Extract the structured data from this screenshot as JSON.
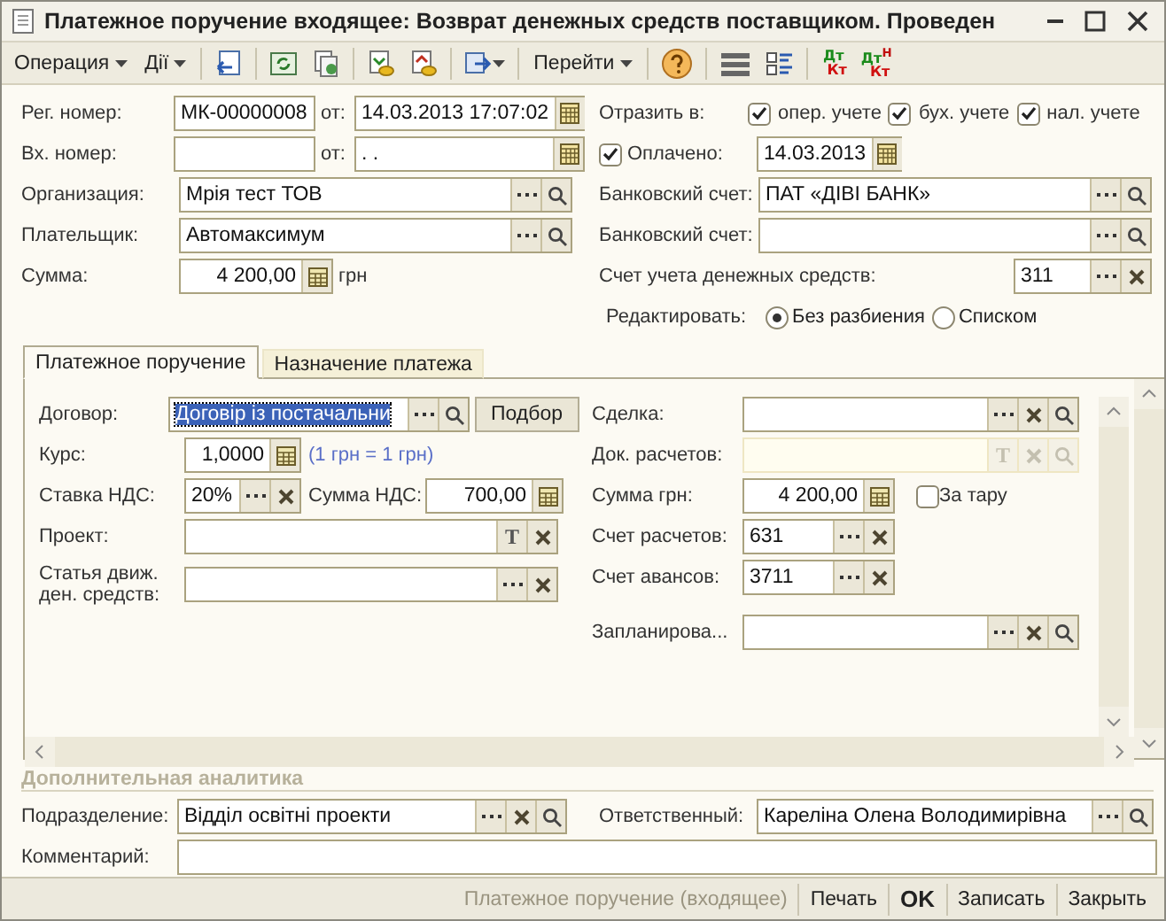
{
  "window": {
    "title": "Платежное поручение входящее: Возврат денежных средств поставщиком. Проведен"
  },
  "toolbar": {
    "menus": [
      "Операция",
      "Дії"
    ],
    "goto_menu": "Перейти",
    "dt_kt": [
      {
        "top": "Дт",
        "bottom": "Кт"
      },
      {
        "top": "Дт",
        "sup": "Н",
        "bottom": "Кт"
      }
    ]
  },
  "header": {
    "reg_number": {
      "label": "Рег. номер:",
      "value": "МК-00000008",
      "date_label": "от:",
      "date": "14.03.2013 17:07:02"
    },
    "in_number": {
      "label": "Вх. номер:",
      "date_label": "от:",
      "date": " .  ."
    },
    "organization": {
      "label": "Организация:",
      "value": "Мрія тест ТОВ",
      "buttons": [
        {
          "kind": "select"
        },
        {
          "kind": "search"
        }
      ]
    },
    "payer": {
      "label": "Плательщик:",
      "value": "Автомаксимум",
      "buttons": [
        {
          "kind": "select"
        },
        {
          "kind": "search"
        }
      ]
    },
    "amount": {
      "label": "Сумма:",
      "value": "4 200,00",
      "unit": "грн"
    },
    "reflect": {
      "label": "Отразить в:",
      "options": [
        {
          "label": "опер. учете",
          "checked": true
        },
        {
          "label": "бух. учете",
          "checked": true
        },
        {
          "label": "нал. учете",
          "checked": true
        }
      ]
    },
    "paid": {
      "label": "Оплачено:",
      "checked": true,
      "date": "14.03.2013"
    },
    "bank_account": {
      "label": "Банковский счет:",
      "value": "ПАТ «ДІВІ БАНК»",
      "buttons": [
        {
          "kind": "select"
        },
        {
          "kind": "search"
        }
      ]
    },
    "bank_account_2": {
      "label": "Банковский счет:",
      "buttons": [
        {
          "kind": "select"
        },
        {
          "kind": "search"
        }
      ]
    },
    "cash_account": {
      "label": "Счет учета денежных средств:",
      "value": "311",
      "buttons": [
        {
          "kind": "select"
        },
        {
          "kind": "clear"
        }
      ]
    },
    "edit_mode": {
      "label": "Редактировать:",
      "options": [
        {
          "label": "Без разбиения",
          "selected": true
        },
        {
          "label": "Списком",
          "selected": false
        }
      ]
    }
  },
  "tabs": [
    {
      "label": "Платежное поручение",
      "selected": true
    },
    {
      "label": "Назначение платежа",
      "selected": false
    }
  ],
  "tab_panel": {
    "contract": {
      "label": "Договор:",
      "value": "Договір із постачальни",
      "highlighted": true,
      "buttons": [
        {
          "kind": "select"
        },
        {
          "kind": "search"
        }
      ],
      "pick_button": "Подбор"
    },
    "rate": {
      "label": "Курс:",
      "value": "1,0000",
      "note": "(1 грн = 1 грн)"
    },
    "vat_rate": {
      "label": "Ставка НДС:",
      "value": "20%",
      "buttons": [
        {
          "kind": "select"
        },
        {
          "kind": "clear"
        }
      ]
    },
    "vat_amount": {
      "label": "Сумма НДС:",
      "value": "700,00"
    },
    "project": {
      "label": "Проект:",
      "buttons": [
        {
          "kind": "text",
          "glyph": "T"
        },
        {
          "kind": "clear"
        }
      ]
    },
    "cash_flow_item": {
      "label": "Статья движ. ден. средств:",
      "buttons": [
        {
          "kind": "select"
        },
        {
          "kind": "clear"
        }
      ]
    },
    "deal": {
      "label": "Сделка:",
      "disabled": false,
      "buttons": [
        {
          "kind": "select"
        },
        {
          "kind": "clear"
        },
        {
          "kind": "search"
        }
      ]
    },
    "settlement_doc": {
      "label": "Док. расчетов:",
      "disabled": true,
      "buttons": [
        {
          "kind": "text",
          "glyph": "T"
        },
        {
          "kind": "clear"
        },
        {
          "kind": "search"
        }
      ]
    },
    "amount_uah": {
      "label": "Сумма грн:",
      "value": "4 200,00"
    },
    "container": {
      "label": "За тару",
      "checked": false
    },
    "settlement_account": {
      "label": "Счет расчетов:",
      "value": "631",
      "buttons": [
        {
          "kind": "select"
        },
        {
          "kind": "clear"
        }
      ]
    },
    "advance_account": {
      "label": "Счет авансов:",
      "value": "3711",
      "buttons": [
        {
          "kind": "select"
        },
        {
          "kind": "clear"
        }
      ]
    },
    "planned": {
      "label": "Запланирова...",
      "disabled": false,
      "buttons": [
        {
          "kind": "select"
        },
        {
          "kind": "clear"
        },
        {
          "kind": "search"
        }
      ]
    }
  },
  "additional": {
    "title": "Дополнительная аналитика",
    "department": {
      "label": "Подразделение:",
      "value": "Відділ освітні проекти",
      "buttons": [
        {
          "kind": "select"
        },
        {
          "kind": "clear"
        },
        {
          "kind": "search"
        }
      ]
    },
    "responsible": {
      "label": "Ответственный:",
      "value": "Кареліна Олена Володимирівна",
      "buttons": [
        {
          "kind": "select"
        },
        {
          "kind": "search"
        }
      ]
    },
    "comment": {
      "label": "Комментарий:"
    }
  },
  "footer": {
    "document_type": "Платежное поручение (входящее)",
    "buttons": [
      {
        "label": "Печать",
        "default": false
      },
      {
        "label": "OK",
        "default": true
      },
      {
        "label": "Записать",
        "default": false
      },
      {
        "label": "Закрыть",
        "default": false
      }
    ]
  }
}
